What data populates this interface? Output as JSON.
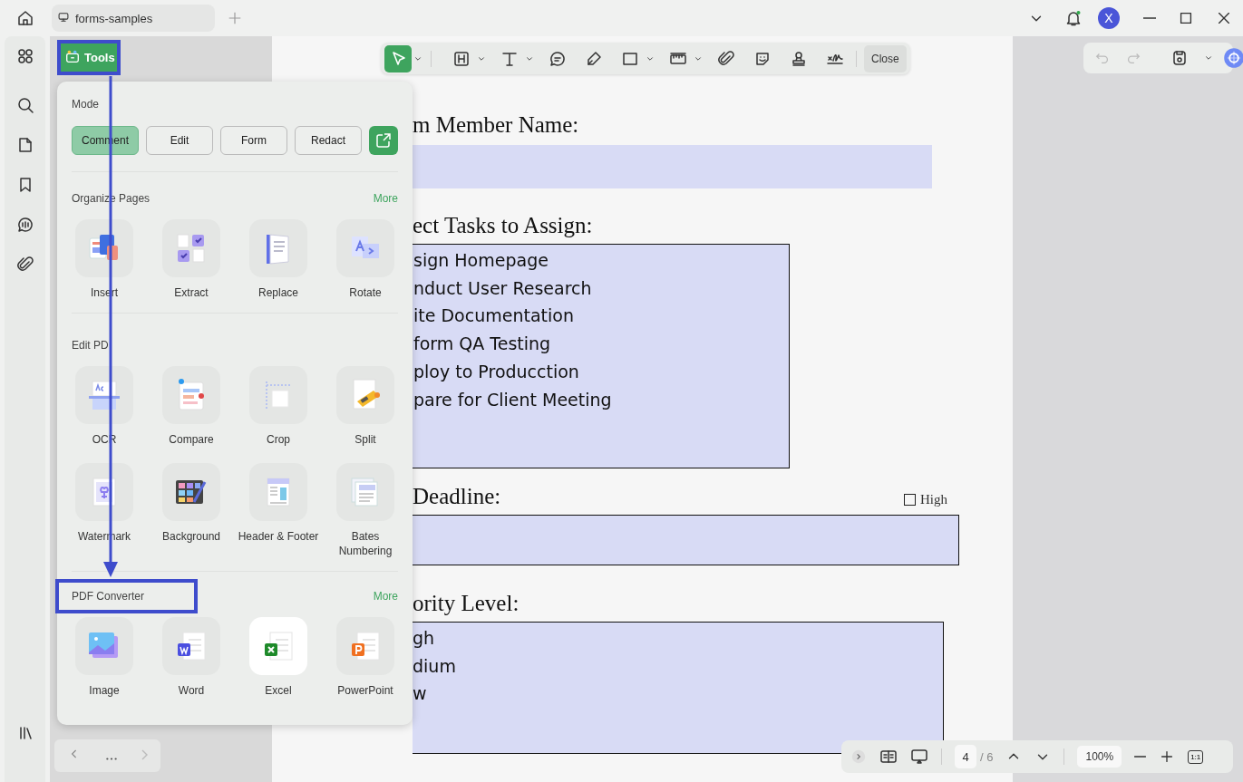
{
  "tab": {
    "title": "forms-samples"
  },
  "account": {
    "initial": "X"
  },
  "tools_button": {
    "label": "Tools",
    "highlighted": true
  },
  "annotation_arrow": true,
  "toolbar": {
    "tools": [
      {
        "selected": true,
        "menu": true
      },
      {
        "selected": false,
        "menu": true
      },
      {
        "selected": false,
        "menu": true
      },
      {
        "selected": false,
        "menu": false
      },
      {
        "selected": false,
        "menu": false
      },
      {
        "selected": false,
        "menu": true
      },
      {
        "selected": false,
        "menu": true
      },
      {
        "selected": false,
        "menu": false
      },
      {
        "selected": false,
        "menu": false
      },
      {
        "selected": false,
        "menu": false
      },
      {
        "selected": false,
        "menu": false
      }
    ],
    "close": "Close"
  },
  "tools_panel": {
    "mode_label": "Mode",
    "modes": [
      {
        "label": "Comment",
        "selected": true
      },
      {
        "label": "Edit",
        "selected": false
      },
      {
        "label": "Form",
        "selected": false
      },
      {
        "label": "Redact",
        "selected": false
      }
    ],
    "sections": [
      {
        "title": "Organize Pages",
        "more": "More",
        "highlighted": false,
        "items": [
          {
            "label": "Insert",
            "hovered": false
          },
          {
            "label": "Extract",
            "hovered": false
          },
          {
            "label": "Replace",
            "hovered": false
          },
          {
            "label": "Rotate",
            "hovered": false
          }
        ]
      },
      {
        "title": "Edit PD",
        "highlighted": false,
        "items": [
          {
            "label": "OCR",
            "hovered": false
          },
          {
            "label": "Compare",
            "hovered": false
          },
          {
            "label": "Crop",
            "hovered": false
          },
          {
            "label": "Split",
            "hovered": false
          },
          {
            "label": "Watermark",
            "hovered": false
          },
          {
            "label": "Background",
            "hovered": false
          },
          {
            "label": "Header & Footer",
            "hovered": false
          },
          {
            "label": "Bates Numbering",
            "hovered": false
          }
        ]
      },
      {
        "title": "PDF Converter",
        "more": "More",
        "highlighted": true,
        "items": [
          {
            "label": "Image",
            "hovered": false
          },
          {
            "label": "Word",
            "hovered": false
          },
          {
            "label": "Excel",
            "hovered": true
          },
          {
            "label": "PowerPoint",
            "hovered": false
          }
        ]
      }
    ]
  },
  "document": {
    "blocks": [
      {
        "kind": "label",
        "text": "m Member Name:"
      },
      {
        "kind": "text_field"
      },
      {
        "kind": "label",
        "text": "ect Tasks to Assign:"
      },
      {
        "kind": "list_box",
        "options": [
          "sign Homepage",
          "nduct User Research",
          "ite Documentation",
          "form QA Testing",
          "ploy to Producction",
          "pare for Client Meeting"
        ]
      },
      {
        "kind": "label",
        "text": "Deadline:",
        "checkbox": {
          "label": "High",
          "checked": false
        }
      },
      {
        "kind": "text_field"
      },
      {
        "kind": "label",
        "text": "ority Level:"
      },
      {
        "kind": "list_box",
        "options": [
          "gh",
          "dium",
          "w"
        ]
      }
    ]
  },
  "page_nav": {
    "current": "4",
    "total": "/ 6",
    "zoom": "100%",
    "actual_size": "1:1"
  }
}
